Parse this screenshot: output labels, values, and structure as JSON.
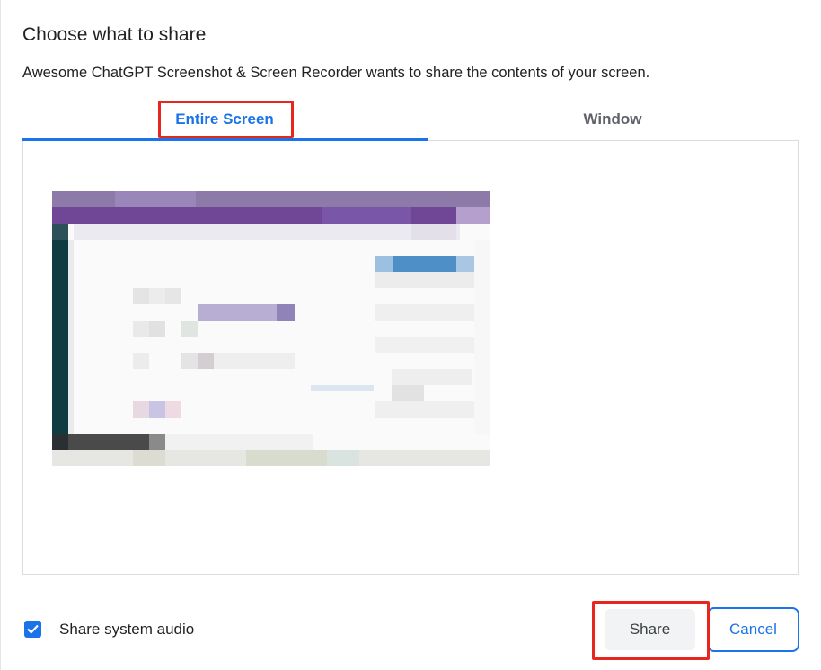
{
  "dialog": {
    "title": "Choose what to share",
    "subtitle": "Awesome ChatGPT Screenshot & Screen Recorder wants to share the contents of your screen."
  },
  "tabs": [
    {
      "label": "Entire Screen",
      "selected": true
    },
    {
      "label": "Window",
      "selected": false
    }
  ],
  "preview": {
    "icon": "screen-thumbnail"
  },
  "footer": {
    "audio_checkbox_checked": true,
    "audio_label": "Share system audio",
    "share_label": "Share",
    "cancel_label": "Cancel"
  },
  "colors": {
    "accent": "#1a73e8",
    "highlight_box": "#e8261f"
  }
}
